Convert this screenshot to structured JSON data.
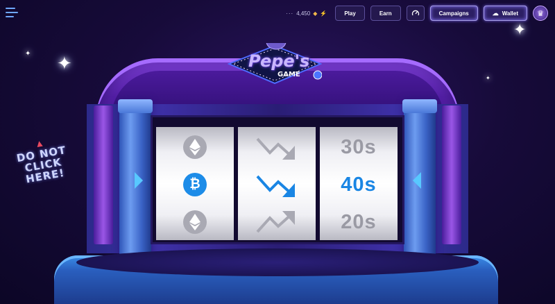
{
  "header": {
    "balance": "4,450",
    "buttons": {
      "play": "Play",
      "earn": "Earn",
      "campaigns": "Campaigns",
      "wallet": "Wallet"
    }
  },
  "logo": {
    "title": "Pepe's",
    "subtitle": "GAME"
  },
  "warning": {
    "line1": "DO NOT",
    "line2": "CLICK HERE!"
  },
  "reels": {
    "coins": [
      {
        "name": "ethereum",
        "symbol": "",
        "selected": false
      },
      {
        "name": "bitcoin",
        "symbol": "₿",
        "selected": true
      },
      {
        "name": "ethereum",
        "symbol": "",
        "selected": false
      }
    ],
    "directions": [
      {
        "trend": "down",
        "selected": false
      },
      {
        "trend": "down",
        "selected": true
      },
      {
        "trend": "up",
        "selected": false
      }
    ],
    "times": [
      {
        "label": "30s",
        "selected": false
      },
      {
        "label": "40s",
        "selected": true
      },
      {
        "label": "20s",
        "selected": false
      }
    ]
  },
  "colors": {
    "accent": "#1a86e4",
    "inactive": "#9a9aa4",
    "machine_purple": "#5620a8"
  }
}
